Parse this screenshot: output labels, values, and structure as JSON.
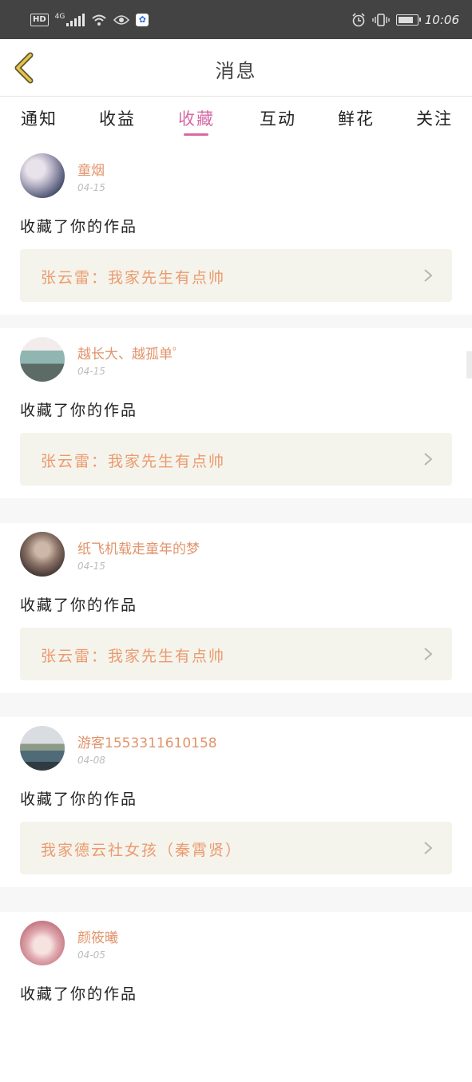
{
  "status_bar": {
    "hd": "HD",
    "network": "4G",
    "time": "10:06",
    "icons": [
      "hd-icon",
      "signal-icon",
      "wifi-icon",
      "eye-icon",
      "baidu-app-icon",
      "alarm-icon",
      "vibrate-icon",
      "battery-icon"
    ]
  },
  "nav": {
    "title": "消息",
    "back_icon": "chevron-left-icon",
    "accent": "#d6b04a"
  },
  "tabs": [
    {
      "label": "通知",
      "active": false
    },
    {
      "label": "收益",
      "active": false
    },
    {
      "label": "收藏",
      "active": true
    },
    {
      "label": "互动",
      "active": false
    },
    {
      "label": "鲜花",
      "active": false
    },
    {
      "label": "关注",
      "active": false
    }
  ],
  "accent_color": "#d66aa5",
  "username_color": "#e1946b",
  "messages": [
    {
      "username": "童烟",
      "time": "04-15",
      "action": "收藏了你的作品",
      "work": "张云雷：我家先生有点帅"
    },
    {
      "username": "越长大、越孤单゜",
      "time": "04-15",
      "action": "收藏了你的作品",
      "work": "张云雷：我家先生有点帅"
    },
    {
      "username": "纸飞机载走童年的梦",
      "time": "04-15",
      "action": "收藏了你的作品",
      "work": "张云雷：我家先生有点帅"
    },
    {
      "username": "游客15533116101​58",
      "time": "04-08",
      "action": "收藏了你的作品",
      "work": "我家德云社女孩（秦霄贤）"
    },
    {
      "username": "颜筱曦",
      "time": "04-05",
      "action": "收藏了你的作品",
      "work": ""
    }
  ]
}
